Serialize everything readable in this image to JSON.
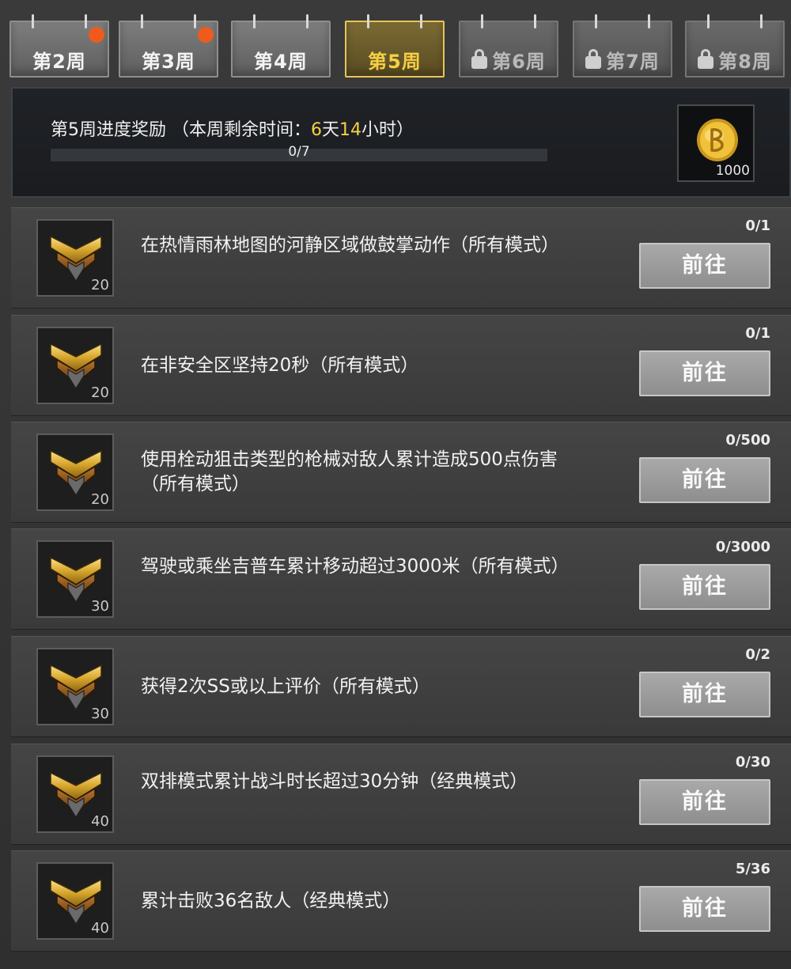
{
  "tabs": [
    {
      "label": "第2周",
      "state": "normal",
      "badge": true
    },
    {
      "label": "第3周",
      "state": "normal",
      "badge": true
    },
    {
      "label": "第4周",
      "state": "normal",
      "badge": false
    },
    {
      "label": "第5周",
      "state": "active",
      "badge": false
    },
    {
      "label": "第6周",
      "state": "locked",
      "badge": false
    },
    {
      "label": "第7周",
      "state": "locked",
      "badge": false
    },
    {
      "label": "第8周",
      "state": "locked",
      "badge": false
    }
  ],
  "progress": {
    "title_prefix": "第5周进度奖励 （本周剩余时间：",
    "days": "6",
    "days_unit": "天",
    "hours": "14",
    "hours_unit": "小时",
    "title_suffix": "）",
    "text": "0/7",
    "fraction": 0,
    "reward_icon": "bcoin-icon",
    "reward_count": "1000"
  },
  "tasks": [
    {
      "desc": "在热情雨林地图的河静区域做鼓掌动作（所有模式）",
      "points": "20",
      "progress": "0/1",
      "button": "前往"
    },
    {
      "desc": "在非安全区坚持20秒（所有模式）",
      "points": "20",
      "progress": "0/1",
      "button": "前往"
    },
    {
      "desc": "使用栓动狙击类型的枪械对敌人累计造成500点伤害（所有模式）",
      "points": "20",
      "progress": "0/500",
      "button": "前往"
    },
    {
      "desc": "驾驶或乘坐吉普车累计移动超过3000米（所有模式）",
      "points": "30",
      "progress": "0/3000",
      "button": "前往"
    },
    {
      "desc": "获得2次SS或以上评价（所有模式）",
      "points": "30",
      "progress": "0/2",
      "button": "前往"
    },
    {
      "desc": "双排模式累计战斗时长超过30分钟（经典模式）",
      "points": "40",
      "progress": "0/30",
      "button": "前往"
    },
    {
      "desc": "累计击败36名敌人（经典模式）",
      "points": "40",
      "progress": "5/36",
      "button": "前往"
    }
  ],
  "colors": {
    "accent": "#f5cf45",
    "badge": "#ee5b1c",
    "button": "#9c9c9c"
  }
}
